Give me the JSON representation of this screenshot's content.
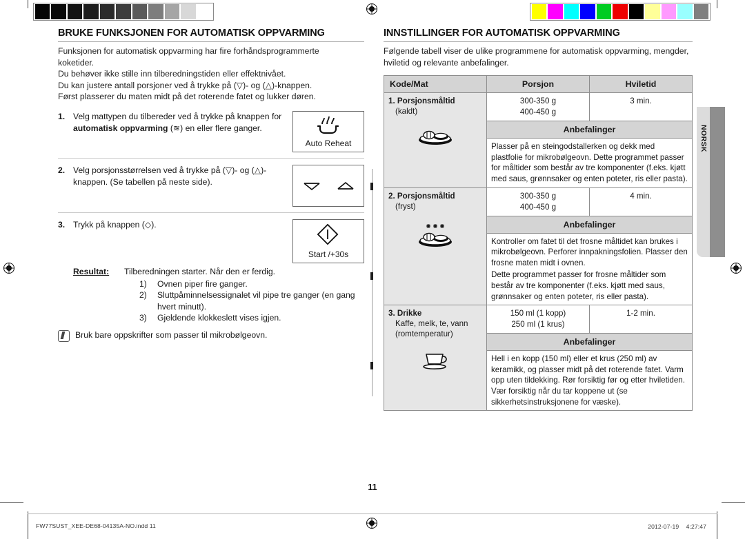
{
  "calibration": {
    "grayscale_patches": [
      "#050505",
      "#090909",
      "#121212",
      "#1d1d1d",
      "#2b2b2b",
      "#3d3d3d",
      "#5a5a5a",
      "#7d7d7d",
      "#a5a5a5",
      "#d8d8d8",
      "#ffffff"
    ],
    "color_patches": [
      "#ffff00",
      "#ff00ff",
      "#00ffff",
      "#0000ff",
      "#00cc22",
      "#ee0000",
      "#000000",
      "#ffff99",
      "#ff99ff",
      "#99ffff",
      "#808080"
    ]
  },
  "left_column": {
    "title": "BRUKE FUNKSJONEN FOR AUTOMATISK OPPVARMING",
    "intro": "Funksjonen for automatisk oppvarming har fire forhåndsprogrammerte koketider.\nDu behøver ikke stille inn tilberedningstiden eller effektnivået.\nDu kan justere antall porsjoner ved å trykke på (▽)- og (△)-knappen.\nFørst plasserer du maten midt på det roterende fatet og lukker døren.",
    "intro_lines": [
      "Funksjonen for automatisk oppvarming har fire forhåndsprogrammerte",
      "koketider.",
      "Du behøver ikke stille inn tilberedningstiden eller effektnivået.",
      "Du kan justere antall porsjoner ved å trykke på (▽)- og (△)-knappen.",
      "Først plasserer du maten midt på det roterende fatet og lukker døren."
    ],
    "steps": [
      {
        "num": "1.",
        "text_before": "Velg mattypen du tilbereder ved å trykke på knappen for ",
        "text_bold": "automatisk oppvarming",
        "text_after": " (≋) en eller flere ganger.",
        "key_label": "Auto Reheat",
        "key_icon": "auto-reheat-icon"
      },
      {
        "num": "2.",
        "text": "Velg porsjonsstørrelsen ved å trykke på (▽)- og (△)-knappen. (Se tabellen på neste side).",
        "key_label": "",
        "key_icon": "down-up-arrow-icons"
      },
      {
        "num": "3.",
        "text": "Trykk på knappen (◇).",
        "key_label": "Start /+30s",
        "key_icon": "start-diamond-icon"
      }
    ],
    "result": {
      "label": "Resultat:",
      "intro": "Tilberedningen starter. Når den er ferdig.",
      "items": [
        {
          "marker": "1)",
          "text": "Ovnen piper fire ganger."
        },
        {
          "marker": "2)",
          "text": "Sluttpåminnelsessignalet vil pipe tre ganger (en gang hvert minutt)."
        },
        {
          "marker": "3)",
          "text": "Gjeldende klokkeslett vises igjen."
        }
      ]
    },
    "note": "Bruk bare oppskrifter som passer til mikrobølgeovn."
  },
  "right_column": {
    "title": "INNSTILLINGER FOR AUTOMATISK OPPVARMING",
    "intro": "Følgende tabell viser de ulike programmene for automatisk oppvarming, mengder, hviletid og relevante anbefalinger.",
    "table": {
      "headers": [
        "Kode/Mat",
        "Porsjon",
        "Hviletid"
      ],
      "recommendation_header": "Anbefalinger",
      "rows": [
        {
          "code_title": "1. Porsjonsmåltid",
          "code_sub": "(kaldt)",
          "icon": "plate-of-food-icon",
          "portion_lines": [
            "300-350 g",
            "400-450 g"
          ],
          "rest_time": "3 min.",
          "recommendation_paragraphs": [
            "Plasser på en steingodstallerken og dekk med plastfolie for mikrobølgeovn. Dette programmet passer for måltider som består av tre komponenter (f.eks. kjøtt med saus, grønnsaker og enten poteter, ris eller pasta)."
          ]
        },
        {
          "code_title": "2. Porsjonsmåltid",
          "code_sub": "(fryst)",
          "icon": "frozen-plate-of-food-icon",
          "portion_lines": [
            "300-350 g",
            "400-450 g"
          ],
          "rest_time": "4 min.",
          "recommendation_paragraphs": [
            "Kontroller om fatet til det frosne måltidet kan brukes i mikrobølgeovn. Perforer innpakningsfolien. Plasser den frosne maten midt i ovnen.",
            "Dette programmet passer for frosne måltider som består av tre komponenter (f.eks. kjøtt med saus, grønnsaker og enten poteter, ris eller pasta)."
          ]
        },
        {
          "code_title": "3. Drikke",
          "code_sub": "Kaffe, melk, te, vann (romtemperatur)",
          "icon": "cup-of-coffee-icon",
          "portion_lines": [
            "150 ml (1 kopp)",
            "250 ml (1 krus)"
          ],
          "rest_time": "1-2 min.",
          "recommendation_paragraphs": [
            "Hell i en kopp (150 ml) eller et krus (250 ml) av keramikk, og plasser midt på det roterende fatet. Varm opp uten tildekking. Rør forsiktig før og etter hviletiden. Vær forsiktig når du tar koppene ut (se sikkerhetsinstruksjonene for væske)."
          ]
        }
      ]
    }
  },
  "side_tab": {
    "label": "NORSK"
  },
  "footer": {
    "page_number": "11",
    "file_name": "FW77SUST_XEE-DE68-04135A-NO.indd   11",
    "timestamp": "2012-07-19   ᅟ4:27:47"
  }
}
